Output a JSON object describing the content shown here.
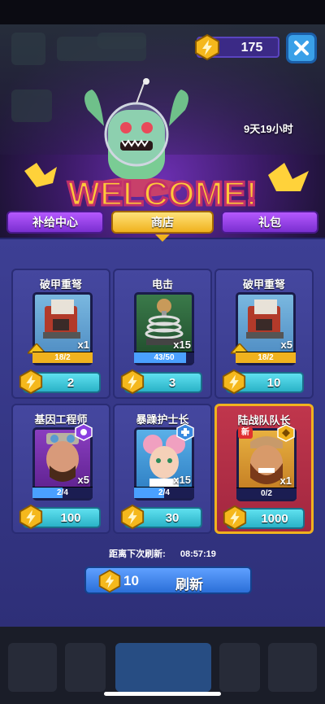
{
  "currency": {
    "icon": "lightning-gem-icon",
    "amount": "175"
  },
  "close": {
    "icon": "close-icon"
  },
  "banner": {
    "timer": "9天19小时",
    "welcome_text": "WELCOME!"
  },
  "tabs": [
    {
      "label": "补给中心",
      "active": false
    },
    {
      "label": "商店",
      "active": true
    },
    {
      "label": "礼包",
      "active": false
    }
  ],
  "shop_items": [
    {
      "title": "破甲重弩",
      "icon": "crossbow-turret-icon",
      "qty": "x1",
      "progress_text": "18/2",
      "progress": 1.0,
      "upgradable": true,
      "price": "2"
    },
    {
      "title": "电击",
      "icon": "tesla-coil-icon",
      "qty": "x15",
      "progress_text": "43/50",
      "progress": 0.86,
      "upgradable": false,
      "price": "3"
    },
    {
      "title": "破甲重弩",
      "icon": "crossbow-turret-icon",
      "qty": "x5",
      "progress_text": "18/2",
      "progress": 1.0,
      "upgradable": true,
      "price": "10"
    },
    {
      "title": "基因工程师",
      "icon": "engineer-hero-icon",
      "qty": "x5",
      "progress_text": "2/4",
      "progress": 0.5,
      "upgradable": false,
      "price": "100",
      "badge": "purple-class-badge-icon"
    },
    {
      "title": "暴躁护士长",
      "icon": "nurse-hero-icon",
      "qty": "x15",
      "progress_text": "2/4",
      "progress": 0.5,
      "upgradable": false,
      "price": "30",
      "badge": "blue-class-badge-icon"
    },
    {
      "title": "陆战队队长",
      "icon": "marine-captain-icon",
      "qty": "x1",
      "progress_text": "0/2",
      "progress": 0.0,
      "upgradable": false,
      "price": "1000",
      "badge": "gold-class-badge-icon",
      "new_tag": "新",
      "special": true
    }
  ],
  "refresh": {
    "label": "距离下次刷新:",
    "countdown": "08:57:19",
    "cost": "10",
    "button_label": "刷新"
  },
  "colors": {
    "panel": "#3d3f94",
    "price": "#2ab3c7",
    "tab_active": "#f0b21e",
    "tab_inactive": "#8a3ee0",
    "special_card": "#b02e46"
  }
}
